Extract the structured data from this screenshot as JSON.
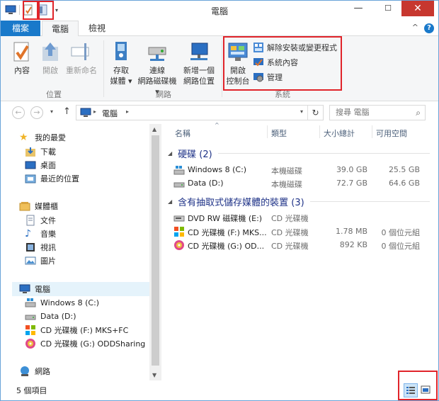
{
  "window": {
    "title": "電腦",
    "minimize": "—",
    "maximize": "☐",
    "close": "✕"
  },
  "tabs": {
    "file": "檔案",
    "computer": "電腦",
    "view": "檢視"
  },
  "ribbon": {
    "location_group": "位置",
    "network_group": "網路",
    "system_group": "系統",
    "properties": "內容",
    "open": "開啟",
    "rename": "重新命名",
    "access_media_1": "存取",
    "access_media_2": "媒體 ▾",
    "map_drive_1": "連線",
    "map_drive_2": "網路磁碟機 ▾",
    "add_network_1": "新增一個",
    "add_network_2": "網路位置",
    "control_panel_1": "開啟",
    "control_panel_2": "控制台",
    "uninstall": "解除安裝或變更程式",
    "system_properties": "系統內容",
    "manage": "管理"
  },
  "address": {
    "path": "電腦",
    "search_placeholder": "搜尋 電腦"
  },
  "nav": {
    "favorites": "我的最愛",
    "downloads": "下載",
    "desktop": "桌面",
    "recent": "最近的位置",
    "libraries": "媒體櫃",
    "documents": "文件",
    "music": "音樂",
    "videos": "視訊",
    "pictures": "圖片",
    "computer": "電腦",
    "win8": "Windows 8 (C:)",
    "data": "Data (D:)",
    "cd_f": "CD 光碟機 (F:) MKS+FC",
    "cd_g": "CD 光碟機 (G:) ODDSharing",
    "network": "網路"
  },
  "columns": {
    "name": "名稱",
    "type": "類型",
    "total": "大小總計",
    "free": "可用空間"
  },
  "groups": {
    "hdd": "硬碟 (2)",
    "removable": "含有抽取式儲存媒體的裝置 (3)"
  },
  "rows": [
    {
      "name": "Windows 8 (C:)",
      "type": "本機磁碟",
      "total": "39.0 GB",
      "free": "25.5 GB"
    },
    {
      "name": "Data (D:)",
      "type": "本機磁碟",
      "total": "72.7 GB",
      "free": "64.6 GB"
    },
    {
      "name": "DVD RW 磁碟機 (E:)",
      "type": "CD 光碟機",
      "total": "",
      "free": ""
    },
    {
      "name": "CD 光碟機 (F:) MKS...",
      "type": "CD 光碟機",
      "total": "1.78 MB",
      "free": "0 個位元組"
    },
    {
      "name": "CD 光碟機 (G:) OD...",
      "type": "CD 光碟機",
      "total": "892 KB",
      "free": "0 個位元組"
    }
  ],
  "status": {
    "count": "5 個項目"
  },
  "colors": {
    "accent": "#1979ca",
    "highlight": "#e0242a"
  }
}
